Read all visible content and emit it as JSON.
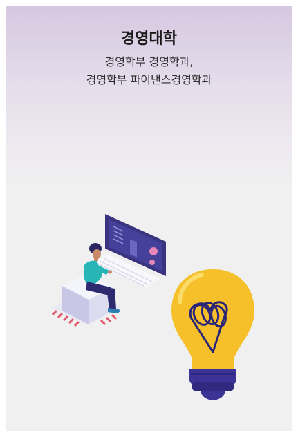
{
  "department": {
    "title": "경영대학",
    "subtitle_line1": "경영학부 경영학과,",
    "subtitle_line2": "경영학부 파이낸스경영학과"
  },
  "illustration": {
    "icons": [
      "person-at-computer-icon",
      "server-chip-icon",
      "lightbulb-icon",
      "university-logo-icon"
    ],
    "colors": {
      "bulb": "#f5c02a",
      "bulb_base": "#3b3496",
      "monitor": "#3a3480",
      "shirt": "#27b5b5",
      "pants": "#2d2a70",
      "chip_pins": "#e2566a",
      "background": "#f0f0f0",
      "header_gradient_top": "#d6c7e0"
    }
  }
}
